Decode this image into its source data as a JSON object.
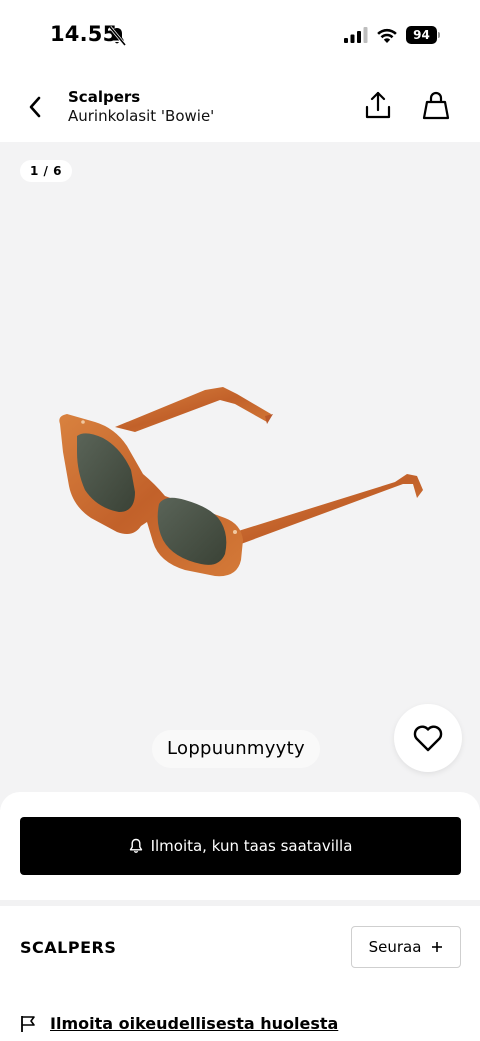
{
  "status_bar": {
    "time": "14.55",
    "battery": "94",
    "icons": [
      "bell-off-icon",
      "signal-icon",
      "wifi-icon",
      "battery-icon"
    ]
  },
  "header": {
    "brand": "Scalpers",
    "product_name": "Aurinkolasit 'Bowie'",
    "icons": [
      "back-arrow-icon",
      "share-icon",
      "shopping-bag-icon"
    ]
  },
  "gallery": {
    "counter": "1 / 6",
    "sold_out_label": "Loppuunmyyty",
    "wishlist_icon": "heart-icon"
  },
  "actions": {
    "notify_label": "Ilmoita, kun taas saatavilla",
    "notify_icon": "bell-icon"
  },
  "brand_section": {
    "name": "SCALPERS",
    "follow_label": "Seuraa",
    "follow_icon": "plus-icon"
  },
  "report": {
    "label": "Ilmoita oikeudellisesta huolesta",
    "icon": "flag-icon"
  },
  "colors": {
    "accent": "#000000",
    "gallery_bg": "#f3f3f4",
    "frame_tortoise": "#c8692e"
  }
}
